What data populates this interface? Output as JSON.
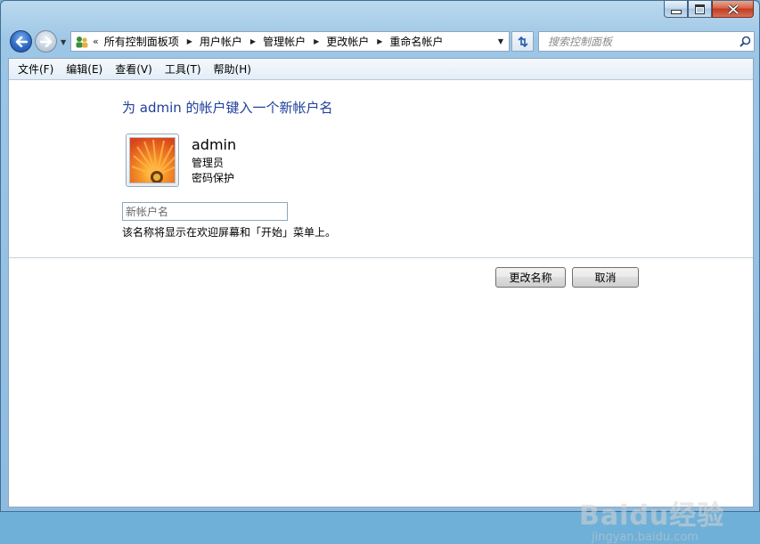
{
  "window": {
    "controls": {
      "minimize_icon": "minimize-icon",
      "maximize_icon": "maximize-icon",
      "close_icon": "close-icon"
    }
  },
  "navigation": {
    "address_icon": "user-accounts-icon",
    "overflow_symbol": "«",
    "breadcrumbs": [
      "所有控制面板项",
      "用户帐户",
      "管理帐户",
      "更改帐户",
      "重命名帐户"
    ],
    "search_placeholder": "搜索控制面板"
  },
  "menubar": {
    "items": [
      "文件(F)",
      "编辑(E)",
      "查看(V)",
      "工具(T)",
      "帮助(H)"
    ]
  },
  "main": {
    "heading": "为 admin 的帐户键入一个新帐户名",
    "account": {
      "name": "admin",
      "type": "管理员",
      "password_status": "密码保护",
      "avatar_icon": "flower-avatar-icon"
    },
    "new_name_input": {
      "placeholder": "新帐户名",
      "value": ""
    },
    "hint": "该名称将显示在欢迎屏幕和「开始」菜单上。",
    "buttons": {
      "rename": "更改名称",
      "cancel": "取消"
    }
  },
  "watermark": {
    "brand": "Baidu经验",
    "url": "jingyan.baidu.com"
  },
  "colors": {
    "heading": "#1e3f9b",
    "window_frame": "#9cc6e6",
    "close_button": "#c23a20"
  }
}
